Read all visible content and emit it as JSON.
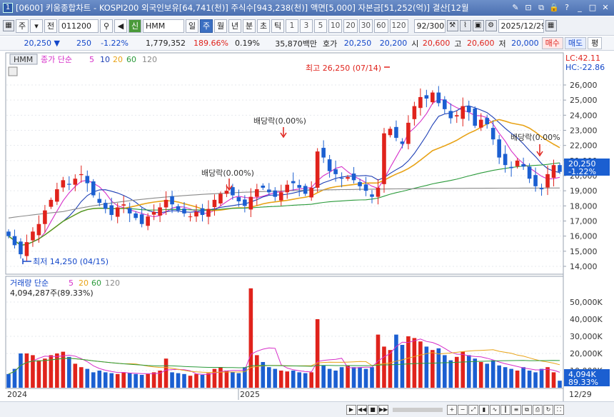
{
  "window": {
    "title": "[0600] 키움종합차트 - KOSPI200 외국인보유[64,741(천)] 주식수[943,238(천)] 액면[5,000] 자본금[51,252(억)] 결산[12월",
    "app_icon": "1",
    "controls": [
      "✎",
      "⊡",
      "⧉",
      "🔒",
      "?",
      "_",
      "□",
      "✕"
    ]
  },
  "toolbar": {
    "market_label": "주",
    "market_dropdown": "▾",
    "prev_btn": "전",
    "code": "011200",
    "search_icon": "⚲",
    "stock_name": "HMM",
    "speaker_icon": "◀",
    "badge": "신",
    "periods": [
      "일",
      "주",
      "월",
      "년",
      "분",
      "초",
      "틱"
    ],
    "active_period": "주",
    "intervals": [
      "1",
      "3",
      "5",
      "10",
      "20",
      "30",
      "60",
      "120"
    ],
    "count": "92/300",
    "date": "2025/12/29"
  },
  "quote": {
    "price": "20,250",
    "arrow": "▼",
    "change": "250",
    "change_pct": "-1.22%",
    "volume": "1,779,352",
    "vol_ratio": "189.66%",
    "turnover": "0.19%",
    "amount": "35,870백만",
    "hoga_label": "호가",
    "ask": "20,250",
    "bid": "20,200",
    "open_label": "시",
    "open": "20,600",
    "high_label": "고",
    "high": "20,600",
    "low_label": "저",
    "low": "20,000",
    "buy_btn": "매수",
    "sell_btn": "매도",
    "eval_btn": "평"
  },
  "price_panel": {
    "name_tag": "HMM",
    "legend": {
      "main": "종가 단순",
      "ma": [
        "5",
        "10",
        "20",
        "60",
        "120"
      ]
    },
    "lc": "LC:42.11",
    "hc": "HC:-22.86",
    "y_ticks": [
      "26,000",
      "25,000",
      "24,000",
      "23,000",
      "22,000",
      "21,000",
      "20,000",
      "19,000",
      "18,000",
      "17,000",
      "16,000",
      "15,000",
      "14,000"
    ],
    "current_label": "20,250",
    "current_pct": "-1.22%",
    "annotations": {
      "high": "최고 26,250 (07/14)",
      "low": "최저 14,250 (04/15)",
      "div1": "배당락(0.00%)",
      "div2": "배당락(0.00%)",
      "div3": "배당락(0.00%"
    }
  },
  "volume_panel": {
    "legend": {
      "main": "거래량 단순",
      "ma": [
        "5",
        "20",
        "60",
        "120"
      ]
    },
    "summary": "4,094,287주(89.33%)",
    "y_ticks": [
      "50,000K",
      "40,000K",
      "30,000K",
      "20,000K",
      "10,000K"
    ],
    "current_label": "4,094K",
    "current_pct": "89.33%"
  },
  "x_axis": {
    "labels": [
      "2024",
      "2025"
    ],
    "last_label": "12/29"
  },
  "colors": {
    "up": "#e0231c",
    "down": "#1b5fd1",
    "ma5": "#d62fc9",
    "ma10": "#1d3fb5",
    "ma20": "#e8a317",
    "ma60": "#2a9a3a",
    "ma120": "#8a8a8a"
  }
}
